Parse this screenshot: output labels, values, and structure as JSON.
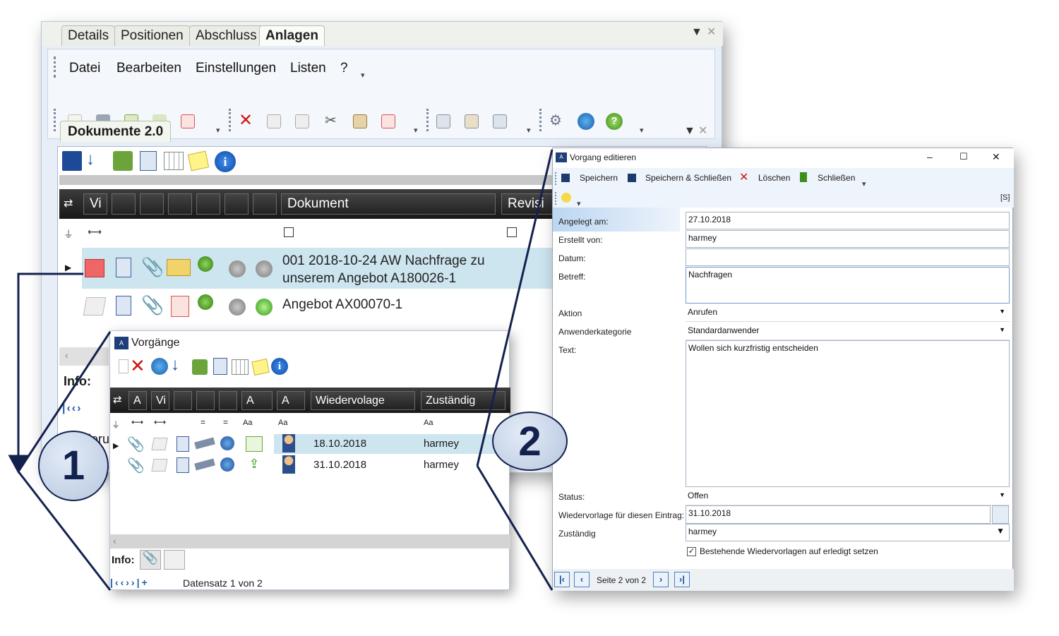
{
  "main": {
    "top_tabs": [
      "Details",
      "Positionen",
      "Abschluss",
      "Anlagen"
    ],
    "active_tab": "Anlagen",
    "menu": [
      "Datei",
      "Bearbeiten",
      "Einstellungen",
      "Listen",
      "?"
    ],
    "doc_tab": "Dokumente 2.0",
    "grid_headers": {
      "first": "Vi",
      "dokument": "Dokument",
      "revision": "Revisi"
    },
    "rows": [
      {
        "text": "001 2018-10-24 AW  Nachfrage zu unserem Angebot A180026-1"
      },
      {
        "text": "Angebot AX00070-1"
      }
    ],
    "info_label": "Info:",
    "sort_label": "Sortieru"
  },
  "vorgaenge": {
    "title": "Vorgänge",
    "headers": {
      "a": "A",
      "vi": "Vi",
      "a2": "A",
      "a3": "A",
      "wiedervorlage": "Wiedervolage",
      "zustaendig": "Zuständig"
    },
    "filter_aa": "Aa",
    "rows": [
      {
        "date": "18.10.2018",
        "user": "harmey"
      },
      {
        "date": "31.10.2018",
        "user": "harmey"
      }
    ],
    "info_label": "Info:",
    "record_status": "Datensatz 1 von 2"
  },
  "edit": {
    "title": "Vorgang editieren",
    "controls": {
      "minimize": "–",
      "maximize": "☐",
      "close": "✕"
    },
    "toolbar": {
      "save": "Speichern",
      "save_close": "Speichern & Schließen",
      "delete": "Löschen",
      "close": "Schließen"
    },
    "s_marker": "[S]",
    "labels": {
      "created_on": "Angelegt am:",
      "created_by": "Erstellt von:",
      "date": "Datum:",
      "subject": "Betreff:",
      "action": "Aktion",
      "category": "Anwenderkategorie",
      "text": "Text:",
      "status": "Status:",
      "followup": "Wiedervorlage für diesen Eintrag:",
      "responsible": "Zuständig"
    },
    "values": {
      "created_on": "27.10.2018",
      "created_by": "harmey",
      "date": "",
      "subject": "Nachfragen",
      "action": "Anrufen",
      "category": "Standardanwender",
      "text": "Wollen sich kurzfristig entscheiden",
      "status": "Offen",
      "followup": "31.10.2018",
      "responsible": "harmey"
    },
    "checkbox_label": "Bestehende Wiedervorlagen auf erledigt setzen",
    "checkbox_checked": true,
    "pager": "Seite 2 von 2"
  },
  "callouts": [
    "1",
    "2"
  ],
  "colors": {
    "grid_header": "#1f1f1f",
    "selection": "#cde5ef",
    "callout_border": "#13214e",
    "delete_red": "#d01414"
  }
}
